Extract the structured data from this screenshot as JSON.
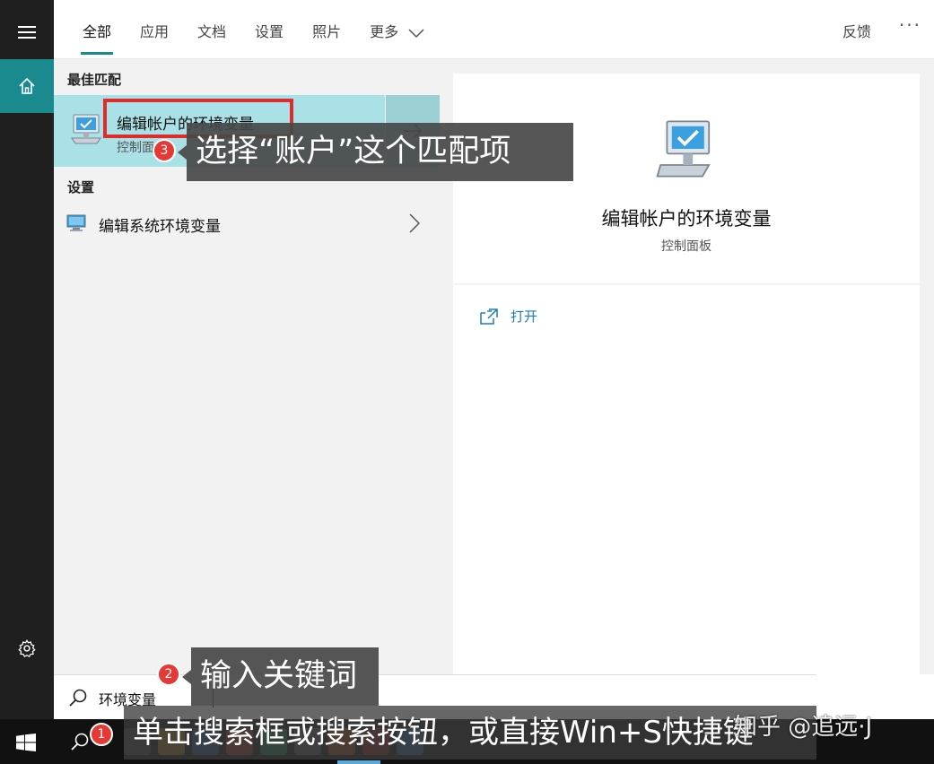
{
  "rail": {
    "menu_icon": "hamburger-icon",
    "home_icon": "home-icon",
    "settings_icon": "gear-icon"
  },
  "tabs": [
    {
      "label": "全部",
      "active": true
    },
    {
      "label": "应用",
      "active": false
    },
    {
      "label": "文档",
      "active": false
    },
    {
      "label": "设置",
      "active": false
    },
    {
      "label": "照片",
      "active": false
    },
    {
      "label": "更多",
      "active": false
    }
  ],
  "header": {
    "feedback_label": "反馈",
    "more_options": "···"
  },
  "results": {
    "best_match_title": "最佳匹配",
    "best_match": {
      "title": "编辑帐户的环境变量",
      "subtitle": "控制面"
    },
    "settings_title": "设置",
    "settings_items": [
      {
        "label": "编辑系统环境变量"
      }
    ]
  },
  "detail": {
    "title": "编辑帐户的环境变量",
    "subtitle": "控制面板",
    "open_label": "打开"
  },
  "search": {
    "value": "环境变量"
  },
  "annotations": {
    "select_tip": "选择“账户”这个匹配项",
    "input_tip": "输入关键词",
    "click_tip": "单击搜索框或搜索按钮，或直接Win+S快捷键",
    "step1": "1",
    "step2": "2",
    "step3": "3"
  },
  "watermark": "知乎 @追远·J",
  "colors": {
    "accent": "#1a8a8f",
    "best_match_bg": "#a9e1e6",
    "link": "#1a7db8",
    "highlight": "#e02b2b"
  }
}
